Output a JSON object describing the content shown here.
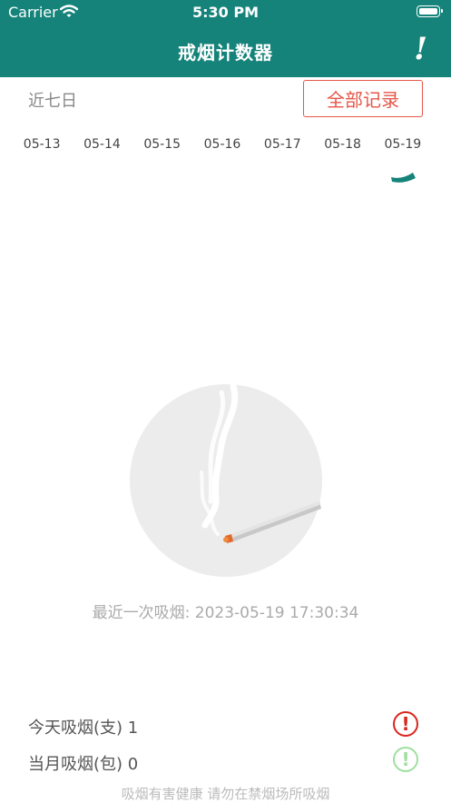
{
  "status_bar": {
    "carrier": "Carrier",
    "time": "5:30 PM"
  },
  "header": {
    "title": "戒烟计数器",
    "alert_label": "!"
  },
  "recent": {
    "label": "近七日",
    "all_records_label": "全部记录"
  },
  "dates": [
    "05-13",
    "05-14",
    "05-15",
    "05-16",
    "05-17",
    "05-18",
    "05-19"
  ],
  "last_smoke": {
    "label": "最近一次吸烟:",
    "datetime": "2023-05-19 17:30:34"
  },
  "stats": {
    "today_label": "今天吸烟(支)",
    "today_value": "1",
    "month_label": "当月吸烟(包)",
    "month_value": "0",
    "today_icon": "exclamation-icon",
    "month_icon": "exclamation-icon"
  },
  "footer": {
    "warning": "吸烟有害健康  请勿在禁烟场所吸烟"
  },
  "colors": {
    "primary": "#15837a",
    "accent_red": "#e5574a",
    "alert_red": "#d8261c",
    "ok_green": "#9fdf9f"
  }
}
